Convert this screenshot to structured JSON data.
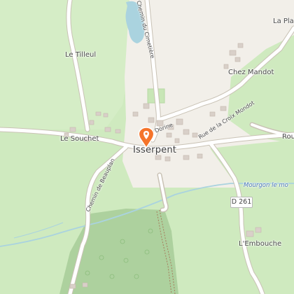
{
  "map": {
    "labels": {
      "main_place": "Isserpent",
      "le_souchet": "Le Souchet",
      "le_tilleul": "Le Tilleul",
      "chez_mandot": "Chez Mandot",
      "la_plan": "La Plan",
      "lembouche": "L'Embouche",
      "chemin_cimetiere": "Chemin du Cimetière",
      "rue_croix_mondot": "Rue de la Croix Mondot",
      "chemin_beauplan": "Chemin de Beauplan",
      "dorine": "Dorine",
      "rou": "Rou",
      "mourgon": "Mourgon le mo"
    },
    "road_number": "D 261",
    "marker_icon": "map-pin-icon",
    "colors": {
      "background": "#cfeabf",
      "village_area": "#f2efe9",
      "forest": "#add19e",
      "water": "#aad3df",
      "marker": "#f5742b"
    }
  }
}
